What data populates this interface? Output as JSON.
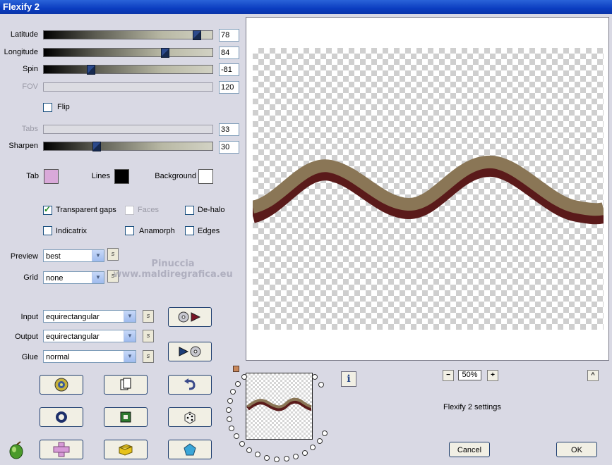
{
  "window": {
    "title": "Flexify 2"
  },
  "sliders": [
    {
      "id": "latitude",
      "label": "Latitude",
      "value": "78",
      "fraction": 0.93,
      "enabled": true
    },
    {
      "id": "longitude",
      "label": "Longitude",
      "value": "84",
      "fraction": 0.73,
      "enabled": true
    },
    {
      "id": "spin",
      "label": "Spin",
      "value": "-81",
      "fraction": 0.27,
      "enabled": true
    },
    {
      "id": "fov",
      "label": "FOV",
      "value": "120",
      "fraction": 0.0,
      "enabled": false
    },
    {
      "id": "tabs",
      "label": "Tabs",
      "value": "33",
      "fraction": 0.0,
      "enabled": false
    },
    {
      "id": "sharpen",
      "label": "Sharpen",
      "value": "30",
      "fraction": 0.3,
      "enabled": true
    }
  ],
  "flip": {
    "label": "Flip",
    "checked": false
  },
  "colors": {
    "tab": {
      "label": "Tab",
      "color": "#d9a9d9"
    },
    "lines": {
      "label": "Lines",
      "color": "#000000"
    },
    "background": {
      "label": "Background",
      "color": "#ffffff"
    }
  },
  "options": {
    "transparent_gaps": {
      "label": "Transparent gaps",
      "checked": true
    },
    "faces": {
      "label": "Faces",
      "checked": false
    },
    "de_halo": {
      "label": "De-halo",
      "checked": false
    },
    "indicatrix": {
      "label": "Indicatrix",
      "checked": false
    },
    "anamorph": {
      "label": "Anamorph",
      "checked": false
    },
    "edges": {
      "label": "Edges",
      "checked": false
    }
  },
  "preview_select": {
    "label": "Preview",
    "value": "best"
  },
  "grid_select": {
    "label": "Grid",
    "value": "none"
  },
  "input_select": {
    "label": "Input",
    "value": "equirectangular"
  },
  "output_select": {
    "label": "Output",
    "value": "equirectangular"
  },
  "glue_select": {
    "label": "Glue",
    "value": "normal"
  },
  "s_button_label": "s",
  "watermark": {
    "line1": "Pinuccia",
    "line2": "www.maldiregrafica.eu"
  },
  "zoom": {
    "value": "50%",
    "minus": "−",
    "plus": "+"
  },
  "settings_label": "Flexify 2 settings",
  "info_label": "i",
  "scroll_up_label": "^",
  "buttons": {
    "cancel": "Cancel",
    "ok": "OK"
  },
  "accent": {
    "title_bar": "#0b3dc0",
    "wave_top": "#8a7656",
    "wave_bottom": "#5a1a1a"
  }
}
